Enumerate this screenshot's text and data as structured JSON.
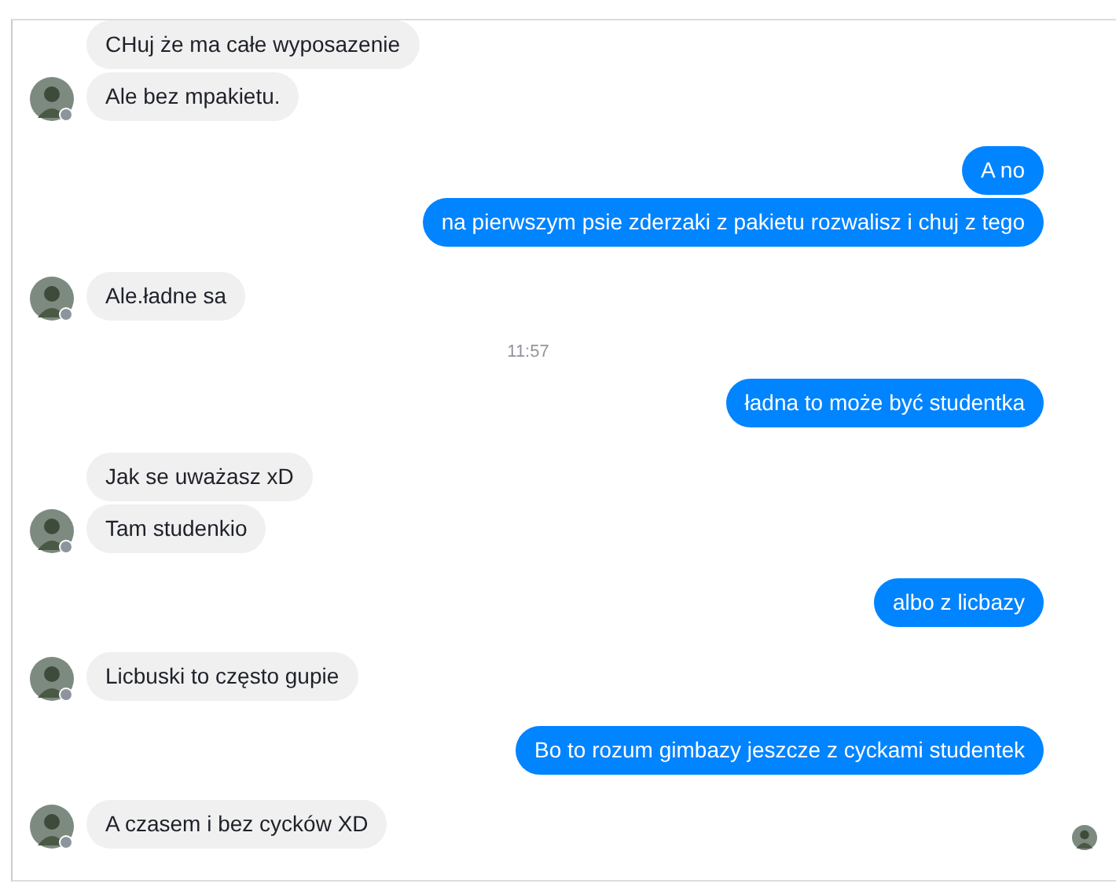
{
  "thread": [
    {
      "kind": "incoming",
      "texts": [
        "CHuj że ma całe wyposazenie",
        "Ale bez mpakietu."
      ]
    },
    {
      "kind": "outgoing",
      "texts": [
        "A no",
        "na pierwszym psie zderzaki z pakietu rozwalisz i chuj z tego"
      ]
    },
    {
      "kind": "incoming",
      "texts": [
        "Ale.ładne sa"
      ]
    },
    {
      "kind": "time",
      "text": "11:57"
    },
    {
      "kind": "outgoing",
      "texts": [
        "ładna to może być studentka"
      ]
    },
    {
      "kind": "incoming",
      "texts": [
        "Jak se uważasz xD",
        "Tam studenkio"
      ]
    },
    {
      "kind": "outgoing",
      "texts": [
        "albo z licbazy"
      ]
    },
    {
      "kind": "incoming",
      "texts": [
        "Licbuski to często gupie"
      ]
    },
    {
      "kind": "outgoing",
      "texts": [
        "Bo to rozum gimbazy jeszcze z cyckami studentek"
      ]
    },
    {
      "kind": "incoming",
      "seen": true,
      "texts": [
        "A czasem i bez cycków XD"
      ]
    }
  ]
}
